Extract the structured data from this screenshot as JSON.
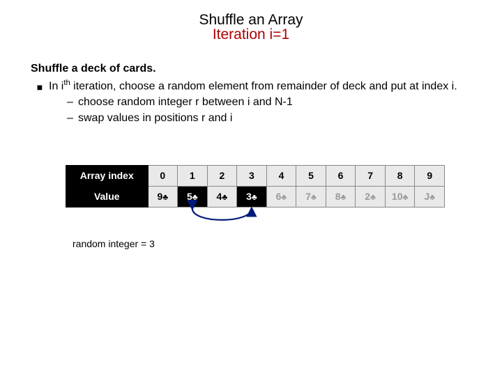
{
  "title": "Shuffle an Array",
  "subtitle": "Iteration i=1",
  "heading": "Shuffle a deck of cards.",
  "bullet_pre": "In i",
  "bullet_sup": "th",
  "bullet_post": " iteration, choose a random element from remainder of deck and put at index i.",
  "sub1": "choose random integer r between i and N-1",
  "sub2": "swap values in positions r and i",
  "table": {
    "row1_label": "Array index",
    "row2_label": "Value",
    "indices": [
      "0",
      "1",
      "2",
      "3",
      "4",
      "5",
      "6",
      "7",
      "8",
      "9"
    ],
    "values": [
      "9",
      "5",
      "4",
      "3",
      "6",
      "7",
      "8",
      "2",
      "10",
      "J"
    ],
    "highlight_cols": [
      1,
      3
    ],
    "dim_from_col": 4
  },
  "club_glyph": "♣",
  "caption": "random integer = 3",
  "chart_data": {
    "type": "table",
    "columns": [
      "Array index",
      "0",
      "1",
      "2",
      "3",
      "4",
      "5",
      "6",
      "7",
      "8",
      "9"
    ],
    "rows": [
      [
        "Value",
        "9♣",
        "5♣",
        "4♣",
        "3♣",
        "6♣",
        "7♣",
        "8♣",
        "2♣",
        "10♣",
        "J♣"
      ]
    ],
    "highlight_columns": [
      1,
      3
    ],
    "dimmed_columns": [
      4,
      5,
      6,
      7,
      8,
      9
    ],
    "swap_arrow": {
      "from_col": 1,
      "to_col": 3
    },
    "title": "Shuffle an Array — Iteration i=1",
    "annotation": "random integer = 3"
  }
}
